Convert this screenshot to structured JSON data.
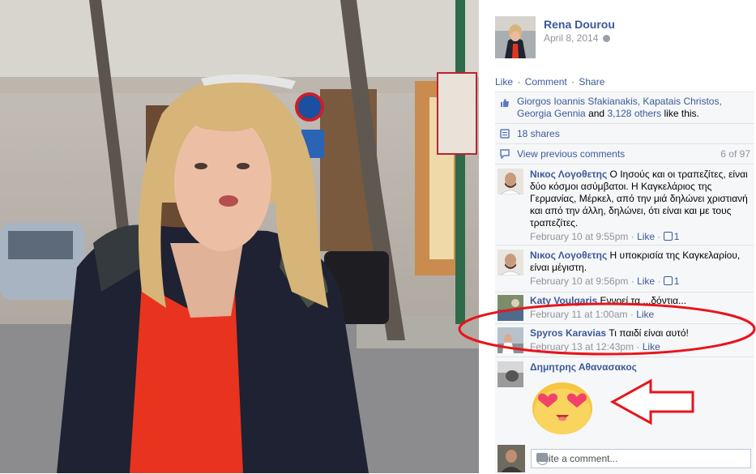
{
  "post": {
    "poster_name": "Rena Dourou",
    "date": "April 8, 2014",
    "actions": [
      "Like",
      "Comment",
      "Share"
    ]
  },
  "likes": {
    "text_prefix": "Giorgos Ioannis Sfakianakis, Kapatais Christos, Georgia Gennia",
    "text_and": "and",
    "others": "3,128 others",
    "text_suffix": "like this."
  },
  "shares": {
    "label": "18 shares"
  },
  "previous": {
    "label": "View previous comments",
    "count": "6 of 97"
  },
  "comments": [
    {
      "author": "Νικος Λογοθετης",
      "text": "Ο Ιησούς και οι τραπεζίτες, είναι δύο κόσμοι ασύμβατοι. Η Καγκελάριος της Γερμανίας, Μέρκελ, από την μιά δηλώνει χριστιανή και από την άλλη, δηλώνει, ότι είναι και με τους τραπεζίτες.",
      "time": "February 10 at 9:55pm",
      "like": "Like",
      "likes": "1"
    },
    {
      "author": "Νικος Λογοθετης",
      "text": "Η υποκρισία της Καγκελαρίου, είναι μέγιστη.",
      "time": "February 10 at 9:56pm",
      "like": "Like",
      "likes": "1"
    },
    {
      "author": "Katy Voulgaris",
      "text": "Εννοεί τα ...δόντια...",
      "time": "February 11 at 1:00am",
      "like": "Like"
    },
    {
      "author": "Spyros Karavias",
      "text": "Τι παιδί είναι αυτό!",
      "time": "February 13 at 12:43pm",
      "like": "Like"
    },
    {
      "author": "Δημητρης Αθανασακος",
      "text": ""
    }
  ],
  "write_comment": {
    "placeholder": "Write a comment..."
  },
  "icons": [
    "thumbs-up-icon",
    "share-icon",
    "comment-bubble-icon",
    "camera-icon",
    "smiley-icon",
    "globe-icon"
  ],
  "colors": {
    "link": "#3b5998",
    "annotation": "#e8141b",
    "muted": "#90949c",
    "ufi_bg": "#f6f7f9"
  }
}
